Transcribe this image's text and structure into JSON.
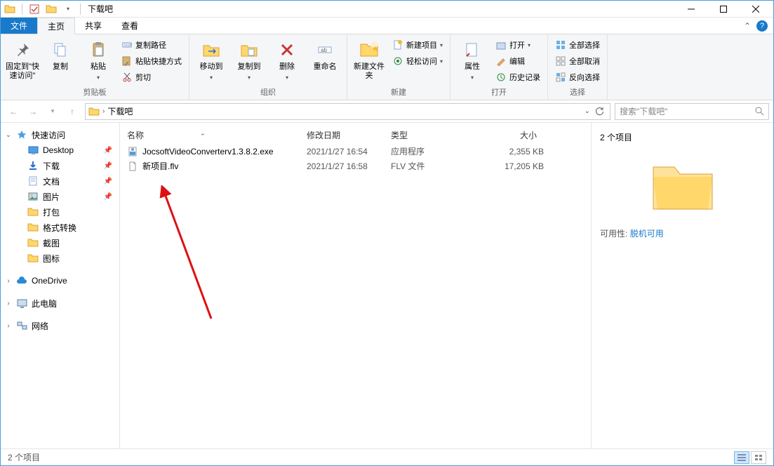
{
  "window": {
    "title": "下载吧"
  },
  "tabs": {
    "file": "文件",
    "home": "主页",
    "share": "共享",
    "view": "查看"
  },
  "ribbon": {
    "pin": "固定到\"快速访问\"",
    "copy": "复制",
    "paste": "粘贴",
    "copy_path": "复制路径",
    "paste_shortcut": "粘贴快捷方式",
    "cut": "剪切",
    "group_clipboard": "剪贴板",
    "move_to": "移动到",
    "copy_to": "复制到",
    "delete": "删除",
    "rename": "重命名",
    "group_organize": "组织",
    "new_folder": "新建文件夹",
    "new_item": "新建项目",
    "easy_access": "轻松访问",
    "group_new": "新建",
    "properties": "属性",
    "open": "打开",
    "edit": "编辑",
    "history": "历史记录",
    "group_open": "打开",
    "select_all": "全部选择",
    "select_none": "全部取消",
    "invert_selection": "反向选择",
    "group_select": "选择"
  },
  "nav": {
    "breadcrumb": "下载吧",
    "search_placeholder": "搜索\"下载吧\""
  },
  "sidebar": {
    "quick_access": "快速访问",
    "items": [
      {
        "label": "Desktop",
        "pinned": true
      },
      {
        "label": "下载",
        "pinned": true
      },
      {
        "label": "文档",
        "pinned": true
      },
      {
        "label": "图片",
        "pinned": true
      },
      {
        "label": "打包",
        "pinned": false
      },
      {
        "label": "格式转换",
        "pinned": false
      },
      {
        "label": "截图",
        "pinned": false
      },
      {
        "label": "图标",
        "pinned": false
      }
    ],
    "onedrive": "OneDrive",
    "this_pc": "此电脑",
    "network": "网络"
  },
  "columns": {
    "name": "名称",
    "date": "修改日期",
    "type": "类型",
    "size": "大小"
  },
  "files": [
    {
      "name": "JocsoftVideoConverterv1.3.8.2.exe",
      "date": "2021/1/27 16:54",
      "type": "应用程序",
      "size": "2,355 KB",
      "icon": "exe"
    },
    {
      "name": "新项目.flv",
      "date": "2021/1/27 16:58",
      "type": "FLV 文件",
      "size": "17,205 KB",
      "icon": "file"
    }
  ],
  "preview": {
    "item_count": "2 个项目",
    "availability_label": "可用性:",
    "availability_value": "脱机可用"
  },
  "status": {
    "text": "2 个项目"
  }
}
